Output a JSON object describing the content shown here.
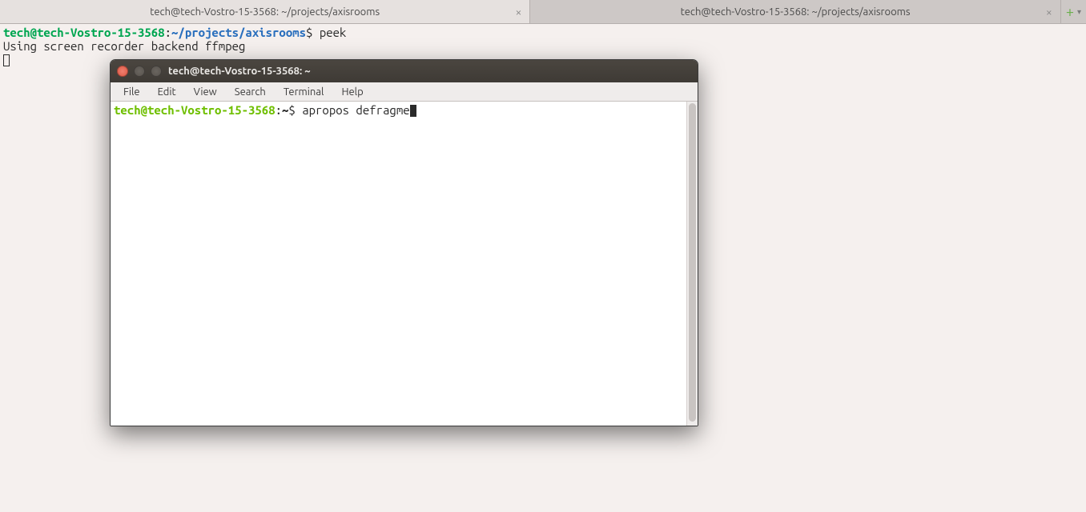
{
  "tabs": {
    "items": [
      {
        "title": "tech@tech-Vostro-15-3568: ~/projects/axisrooms"
      },
      {
        "title": "tech@tech-Vostro-15-3568: ~/projects/axisrooms"
      }
    ]
  },
  "bg_terminal": {
    "prompt_user": "tech@tech-Vostro-15-3568",
    "prompt_sep": ":",
    "prompt_path": "~/projects/axisrooms",
    "prompt_end": "$ ",
    "command": "peek",
    "output_line": "Using screen recorder backend ffmpeg"
  },
  "window": {
    "title": "tech@tech-Vostro-15-3568: ~",
    "menus": [
      "File",
      "Edit",
      "View",
      "Search",
      "Terminal",
      "Help"
    ],
    "term": {
      "prompt_user": "tech@tech-Vostro-15-3568",
      "prompt_sep": ":",
      "prompt_path": "~",
      "prompt_end": "$ ",
      "command": "apropos defragme"
    }
  },
  "icons": {
    "tab_close": "×",
    "plus": "+",
    "dropdown": "▾"
  }
}
